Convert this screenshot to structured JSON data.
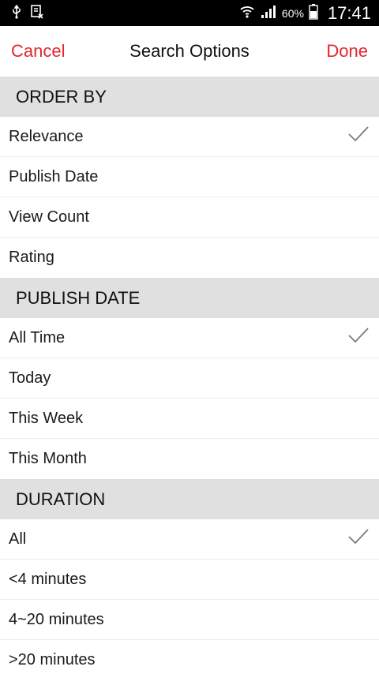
{
  "status_bar": {
    "battery_percent": "60%",
    "time": "17:41",
    "icons": [
      "usb-icon",
      "download-icon",
      "wifi-icon",
      "signal-icon",
      "battery-icon"
    ]
  },
  "nav": {
    "cancel_label": "Cancel",
    "title": "Search Options",
    "done_label": "Done"
  },
  "colors": {
    "accent": "#e3262e",
    "section_bg": "#e0e0e0",
    "check": "#7a7a7a"
  },
  "sections": [
    {
      "header": "ORDER BY",
      "options": [
        {
          "label": "Relevance",
          "selected": true
        },
        {
          "label": "Publish Date",
          "selected": false
        },
        {
          "label": "View Count",
          "selected": false
        },
        {
          "label": "Rating",
          "selected": false
        }
      ]
    },
    {
      "header": "PUBLISH DATE",
      "options": [
        {
          "label": "All Time",
          "selected": true
        },
        {
          "label": "Today",
          "selected": false
        },
        {
          "label": "This Week",
          "selected": false
        },
        {
          "label": "This Month",
          "selected": false
        }
      ]
    },
    {
      "header": "DURATION",
      "options": [
        {
          "label": "All",
          "selected": true
        },
        {
          "label": "<4 minutes",
          "selected": false
        },
        {
          "label": "4~20 minutes",
          "selected": false
        },
        {
          "label": ">20 minutes",
          "selected": false
        }
      ]
    }
  ]
}
